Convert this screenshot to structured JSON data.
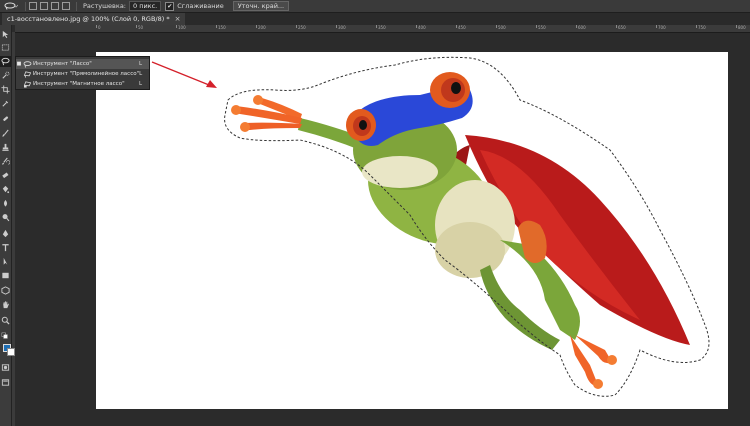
{
  "options_bar": {
    "feather_label": "Растушевка:",
    "feather_value": "0 пикс.",
    "antialias_label": "Сглаживание",
    "refine_edge_label": "Уточн. край..."
  },
  "document_tab": {
    "title": "c1-восстановлено.jpg @ 100% (Слой 0, RGB/8) *",
    "close": "×"
  },
  "ruler_numbers": [
    "0",
    "50",
    "100",
    "150",
    "200",
    "250",
    "300",
    "350",
    "400",
    "450",
    "500",
    "550",
    "600",
    "650",
    "700",
    "750",
    "800"
  ],
  "tool_flyout": {
    "items": [
      {
        "label": "Инструмент \"Лассо\"",
        "shortcut": "L",
        "selected": true,
        "icon": "lasso-icon"
      },
      {
        "label": "Инструмент \"Прямолинейное лассо\"",
        "shortcut": "L",
        "selected": false,
        "icon": "polygonal-lasso-icon"
      },
      {
        "label": "Инструмент \"Магнитное лассо\"",
        "shortcut": "L",
        "selected": false,
        "icon": "magnetic-lasso-icon"
      }
    ]
  },
  "colors": {
    "foreground": "#1f6fb5",
    "background": "#ffffff",
    "arrow": "#d4202a",
    "selection": "#333333"
  }
}
